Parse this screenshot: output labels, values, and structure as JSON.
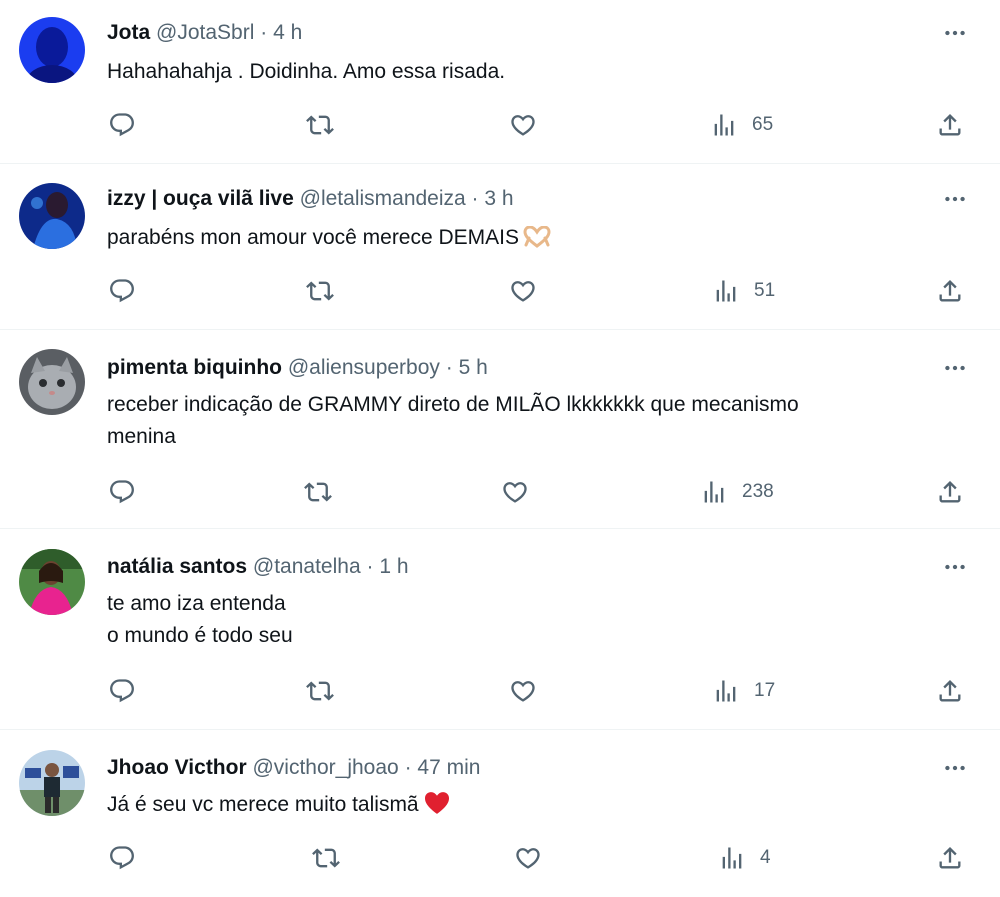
{
  "tweets": [
    {
      "name": "Jota",
      "handle": "@JotaSbrl",
      "time": "4 h",
      "lines": [
        "Hahahahahja . Doidinha. Amo essa risada."
      ],
      "views": "65",
      "avatar_color": "#1b3df0"
    },
    {
      "name": "izzy | ouça vilã live",
      "handle": "@letalismandeiza",
      "time": "3 h",
      "lines": [
        "parabéns mon amour você merece DEMAIS"
      ],
      "emoji": "heart-hands",
      "views": "51",
      "avatar_color": "#0d2a8a"
    },
    {
      "name": "pimenta biquinho",
      "handle": "@aliensuperboy",
      "time": "5 h",
      "lines": [
        "receber indicação de GRAMMY direto de MILÃO lkkkkkkk que mecanismo",
        "menina"
      ],
      "views": "238",
      "avatar_color": "#8a8f96"
    },
    {
      "name": "natália santos",
      "handle": "@tanatelha",
      "time": "1 h",
      "lines": [
        "te amo iza entenda",
        "o mundo é todo seu"
      ],
      "views": "17",
      "avatar_color": "#3e7a3a"
    },
    {
      "name": "Jhoao Victhor",
      "handle": "@victhor_jhoao",
      "time": "47 min",
      "lines": [
        "Já é seu vc merece muito talismã"
      ],
      "emoji": "red-heart",
      "views": "4",
      "avatar_color": "#7fa2c4"
    }
  ],
  "icons": {
    "reply": "reply-icon",
    "retweet": "retweet-icon",
    "like": "like-icon",
    "views": "views-icon",
    "share": "share-icon",
    "more": "more-icon"
  },
  "colors": {
    "text": "#0f1419",
    "secondary": "#536471",
    "divider": "#eff3f4"
  }
}
